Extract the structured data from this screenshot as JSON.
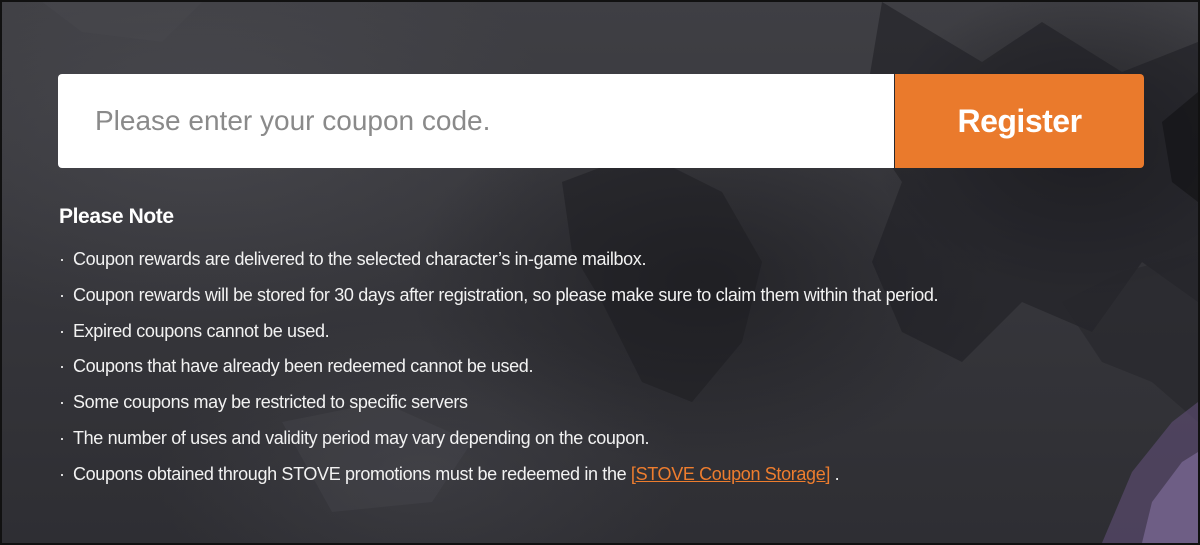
{
  "coupon": {
    "placeholder": "Please enter your coupon code.",
    "value": "",
    "register_label": "Register"
  },
  "notes": {
    "title": "Please Note",
    "bullet": "·",
    "items": [
      "Coupon rewards are delivered to the selected character’s in-game mailbox.",
      "Coupon rewards will be stored for 30 days after registration, so please make sure to claim them within that period.",
      "Expired coupons cannot be used.",
      "Coupons that have already been redeemed cannot be used.",
      "Some coupons may be restricted to specific servers",
      "The number of uses and validity period may vary depending on the coupon."
    ],
    "last_item": {
      "text_before": "Coupons obtained through STOVE promotions must be redeemed in the ",
      "link_text": "[STOVE Coupon Storage]",
      "text_after": " ."
    }
  },
  "colors": {
    "accent": "#ea7a2c",
    "link": "#ee7d2e",
    "background": "#3a3a3f",
    "text": "#ffffff"
  }
}
